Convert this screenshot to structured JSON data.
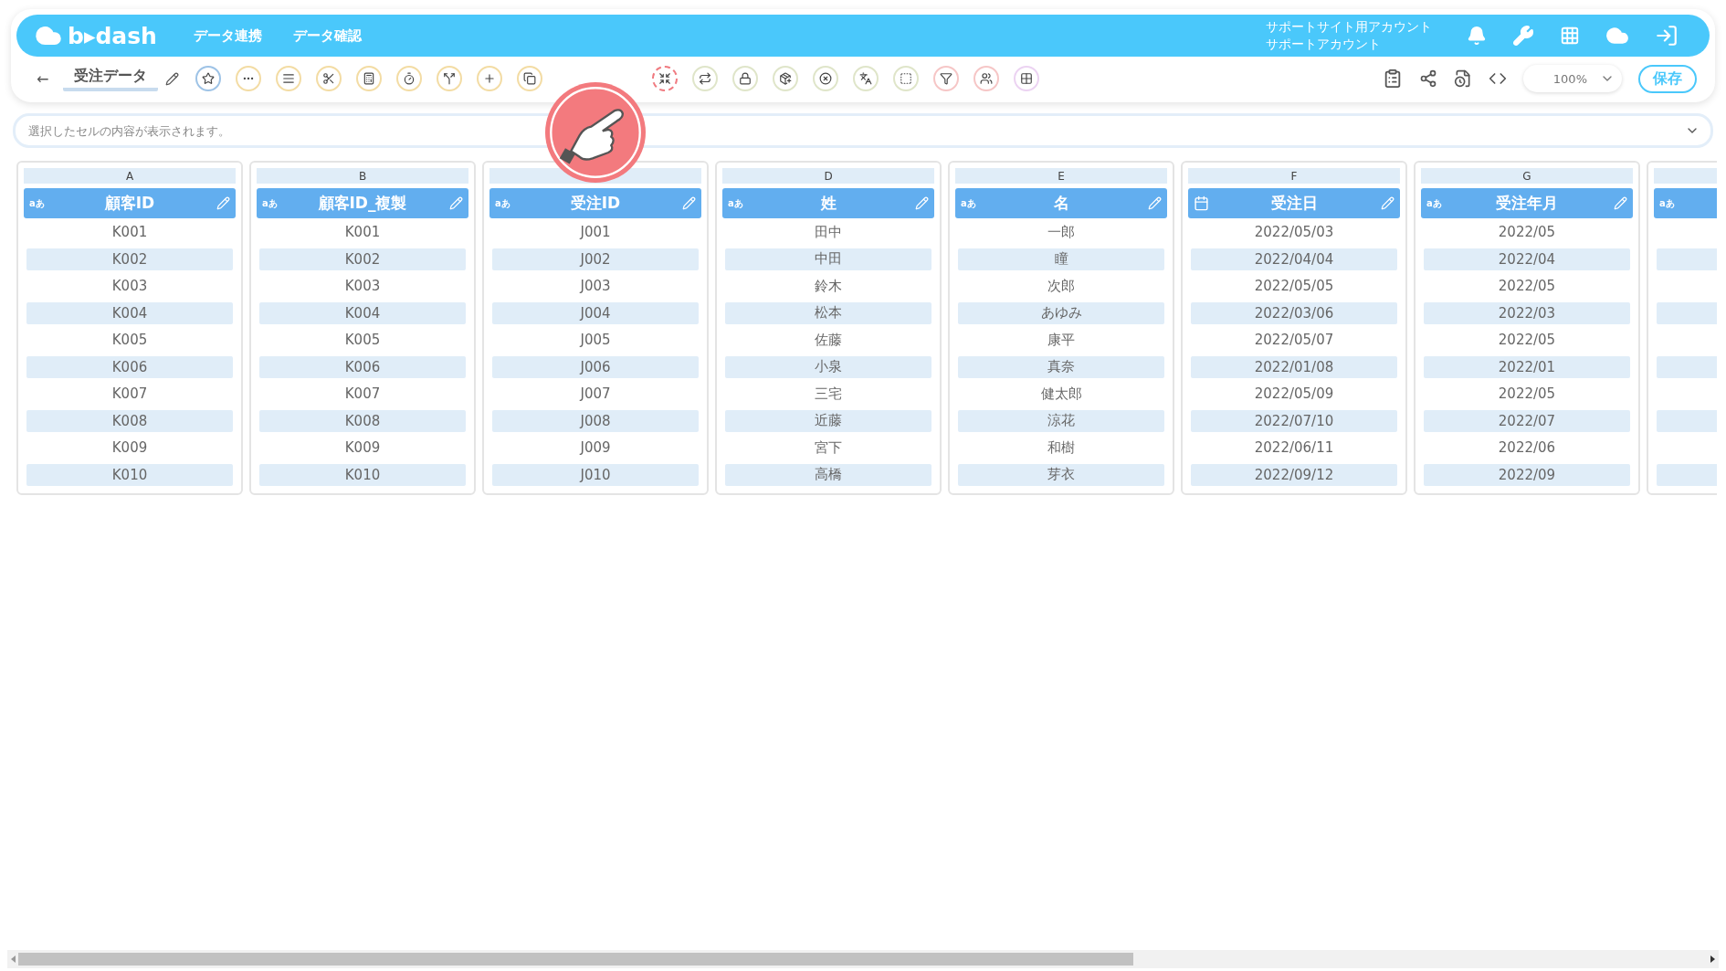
{
  "header": {
    "logo": "b▸dash",
    "nav": [
      "データ連携",
      "データ確認"
    ],
    "account": {
      "line1": "サポートサイト用アカウント",
      "line2": "サポートアカウント"
    }
  },
  "sheet": {
    "back": "←",
    "title": "受注データ"
  },
  "tools": [
    {
      "color": "#9ec3e6",
      "highlighted": false
    },
    {
      "color": "#f3dca4",
      "highlighted": false
    },
    {
      "color": "#f3dca4",
      "highlighted": false
    },
    {
      "color": "#f3dca4",
      "highlighted": false
    },
    {
      "color": "#f3dca4",
      "highlighted": false
    },
    {
      "color": "#f3dca4",
      "highlighted": false
    },
    {
      "color": "#f3dca4",
      "highlighted": false
    },
    {
      "color": "#f3dca4",
      "highlighted": false
    },
    {
      "color": "#f3dca4",
      "highlighted": false
    },
    {
      "color": "#f07a80",
      "highlighted": true
    },
    {
      "color": "#dfe5c9",
      "highlighted": false
    },
    {
      "color": "#dfe5c9",
      "highlighted": false
    },
    {
      "color": "#dfe5c9",
      "highlighted": false
    },
    {
      "color": "#dfe5c9",
      "highlighted": false
    },
    {
      "color": "#dfe5c9",
      "highlighted": false
    },
    {
      "color": "#dfe5c9",
      "highlighted": false
    },
    {
      "color": "#f6c6c6",
      "highlighted": false
    },
    {
      "color": "#f6c6c6",
      "highlighted": false
    },
    {
      "color": "#ecd3f2",
      "highlighted": false
    }
  ],
  "zoom": "100%",
  "save": "保存",
  "cell_view": {
    "placeholder": "選択したセルの内容が表示されます。"
  },
  "columns": [
    {
      "letter": "A",
      "kind": "text",
      "badge": "aあ",
      "name": "顧客ID",
      "cells": [
        "K001",
        "K002",
        "K003",
        "K004",
        "K005",
        "K006",
        "K007",
        "K008",
        "K009",
        "K010"
      ]
    },
    {
      "letter": "B",
      "kind": "text",
      "badge": "aあ",
      "name": "顧客ID_複製",
      "cells": [
        "K001",
        "K002",
        "K003",
        "K004",
        "K005",
        "K006",
        "K007",
        "K008",
        "K009",
        "K010"
      ]
    },
    {
      "kind": "text",
      "badge": "aあ",
      "name": "受注ID",
      "cells": [
        "J001",
        "J002",
        "J003",
        "J004",
        "J005",
        "J006",
        "J007",
        "J008",
        "J009",
        "J010"
      ]
    },
    {
      "letter": "D",
      "kind": "text",
      "badge": "aあ",
      "name": "姓",
      "cells": [
        "田中",
        "中田",
        "鈴木",
        "松本",
        "佐藤",
        "小泉",
        "三宅",
        "近藤",
        "宮下",
        "高橋"
      ]
    },
    {
      "letter": "E",
      "kind": "text",
      "badge": "aあ",
      "name": "名",
      "cells": [
        "一郎",
        "瞳",
        "次郎",
        "あゆみ",
        "康平",
        "真奈",
        "健太郎",
        "涼花",
        "和樹",
        "芽衣"
      ]
    },
    {
      "letter": "F",
      "kind": "date",
      "name": "受注日",
      "cells": [
        "2022/05/03",
        "2022/04/04",
        "2022/05/05",
        "2022/03/06",
        "2022/05/07",
        "2022/01/08",
        "2022/05/09",
        "2022/07/10",
        "2022/06/11",
        "2022/09/12"
      ]
    },
    {
      "letter": "G",
      "kind": "text",
      "badge": "aあ",
      "name": "受注年月",
      "cells": [
        "2022/05",
        "2022/04",
        "2022/05",
        "2022/03",
        "2022/05",
        "2022/01",
        "2022/05",
        "2022/07",
        "2022/06",
        "2022/09"
      ]
    },
    {
      "kind": "text",
      "badge": "aあ"
    }
  ]
}
